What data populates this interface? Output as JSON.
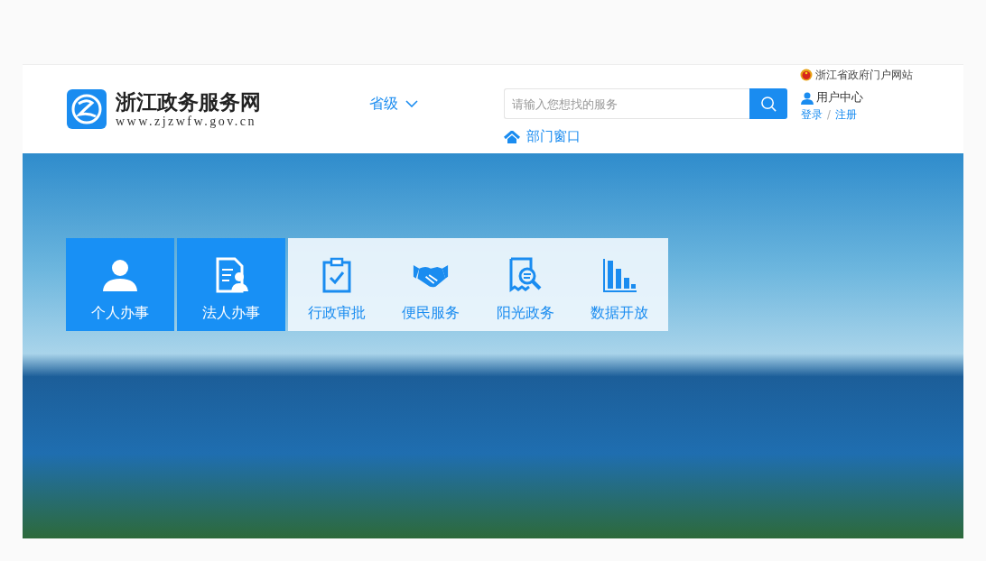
{
  "header": {
    "logo": {
      "title": "浙江政务服务网",
      "url": "www.zjzwfw.gov.cn"
    },
    "level_selector": {
      "label": "省级"
    },
    "portal_link": "浙江省政府门户网站",
    "search": {
      "placeholder": "请输入您想找的服务"
    },
    "user": {
      "title": "用户中心",
      "login": "登录",
      "separator": "/",
      "register": "注册"
    },
    "department_link": "部门窗口"
  },
  "tiles": [
    {
      "label": "个人办事",
      "kind": "primary"
    },
    {
      "label": "法人办事",
      "kind": "primary"
    },
    {
      "label": "行政审批",
      "kind": "light"
    },
    {
      "label": "便民服务",
      "kind": "light"
    },
    {
      "label": "阳光政务",
      "kind": "light"
    },
    {
      "label": "数据开放",
      "kind": "light"
    }
  ]
}
